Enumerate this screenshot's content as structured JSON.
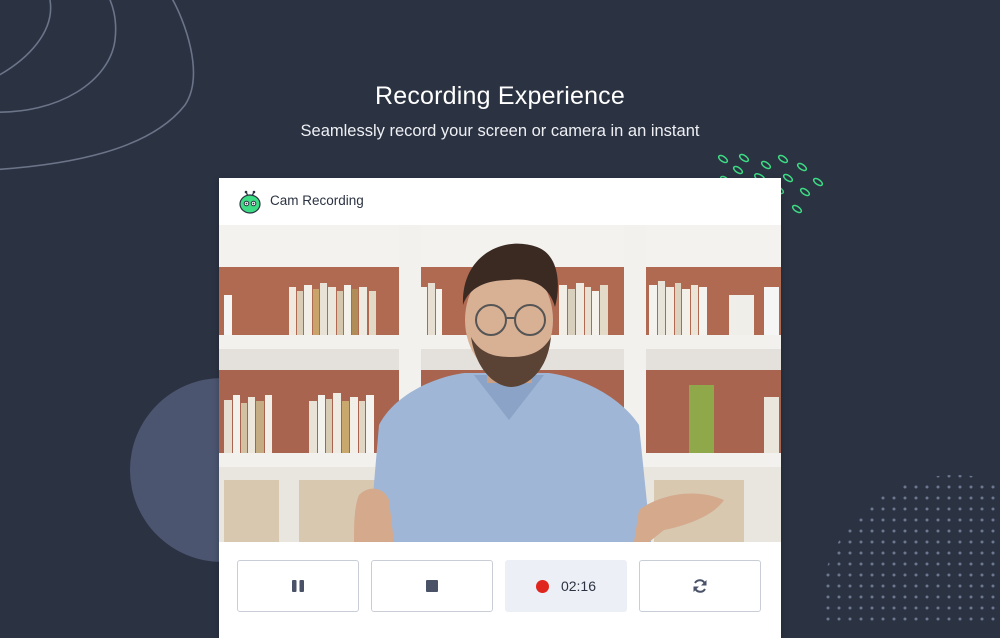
{
  "hero": {
    "title": "Recording Experience",
    "subtitle": "Seamlessly record your screen or camera in an instant"
  },
  "card": {
    "title": "Cam Recording",
    "app_icon": "robot-logo-icon"
  },
  "video": {
    "content": "webcam-feed-man-with-glasses-bookshelf-background"
  },
  "controls": {
    "pause_icon": "pause-icon",
    "stop_icon": "stop-icon",
    "recording_indicator": "record-dot-icon",
    "timer": "02:16",
    "restart_icon": "refresh-icon"
  },
  "colors": {
    "background": "#2b3242",
    "accent_green": "#3ddc84",
    "record_red": "#e0241e",
    "timer_bg": "#eceff5"
  }
}
